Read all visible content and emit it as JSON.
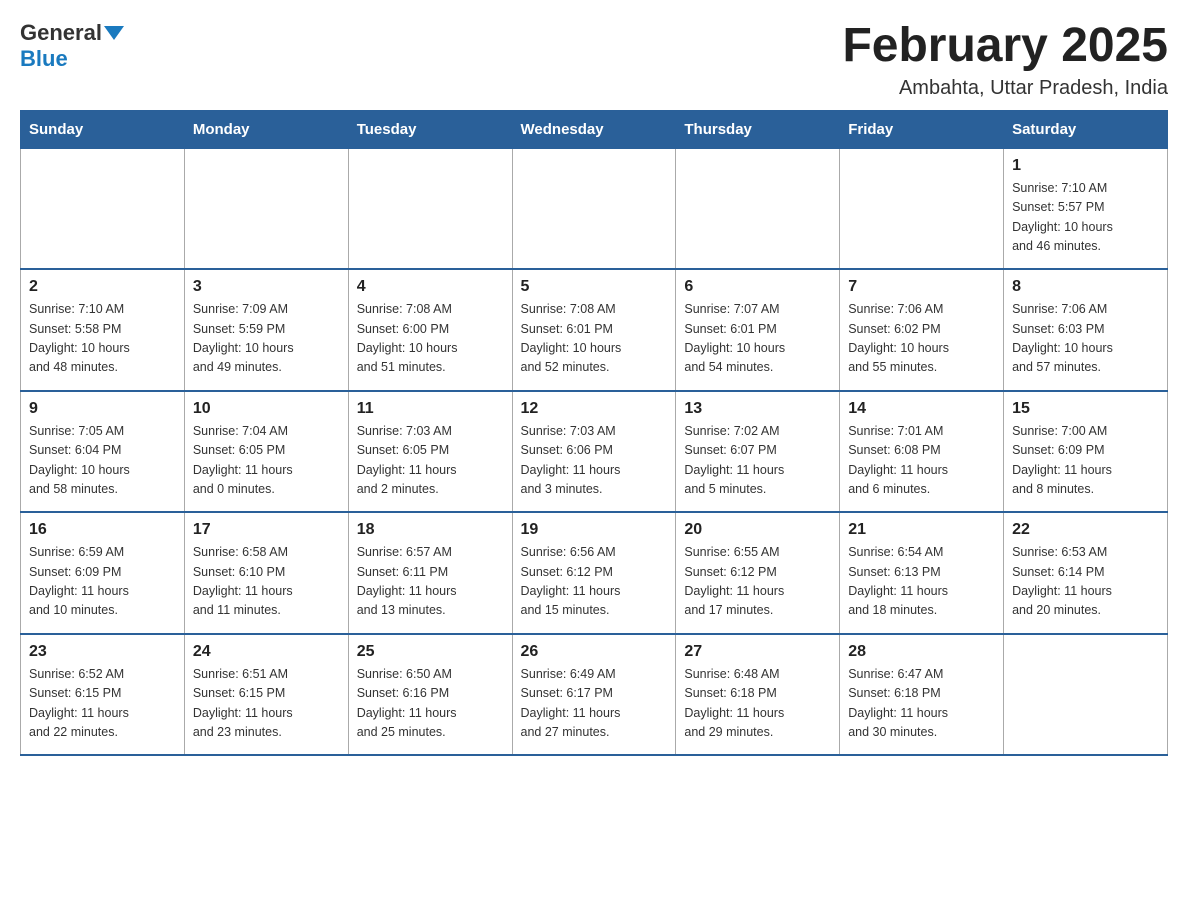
{
  "header": {
    "logo_general": "General",
    "logo_blue": "Blue",
    "month_title": "February 2025",
    "location": "Ambahta, Uttar Pradesh, India"
  },
  "weekdays": [
    "Sunday",
    "Monday",
    "Tuesday",
    "Wednesday",
    "Thursday",
    "Friday",
    "Saturday"
  ],
  "weeks": [
    [
      {
        "day": "",
        "info": ""
      },
      {
        "day": "",
        "info": ""
      },
      {
        "day": "",
        "info": ""
      },
      {
        "day": "",
        "info": ""
      },
      {
        "day": "",
        "info": ""
      },
      {
        "day": "",
        "info": ""
      },
      {
        "day": "1",
        "info": "Sunrise: 7:10 AM\nSunset: 5:57 PM\nDaylight: 10 hours\nand 46 minutes."
      }
    ],
    [
      {
        "day": "2",
        "info": "Sunrise: 7:10 AM\nSunset: 5:58 PM\nDaylight: 10 hours\nand 48 minutes."
      },
      {
        "day": "3",
        "info": "Sunrise: 7:09 AM\nSunset: 5:59 PM\nDaylight: 10 hours\nand 49 minutes."
      },
      {
        "day": "4",
        "info": "Sunrise: 7:08 AM\nSunset: 6:00 PM\nDaylight: 10 hours\nand 51 minutes."
      },
      {
        "day": "5",
        "info": "Sunrise: 7:08 AM\nSunset: 6:01 PM\nDaylight: 10 hours\nand 52 minutes."
      },
      {
        "day": "6",
        "info": "Sunrise: 7:07 AM\nSunset: 6:01 PM\nDaylight: 10 hours\nand 54 minutes."
      },
      {
        "day": "7",
        "info": "Sunrise: 7:06 AM\nSunset: 6:02 PM\nDaylight: 10 hours\nand 55 minutes."
      },
      {
        "day": "8",
        "info": "Sunrise: 7:06 AM\nSunset: 6:03 PM\nDaylight: 10 hours\nand 57 minutes."
      }
    ],
    [
      {
        "day": "9",
        "info": "Sunrise: 7:05 AM\nSunset: 6:04 PM\nDaylight: 10 hours\nand 58 minutes."
      },
      {
        "day": "10",
        "info": "Sunrise: 7:04 AM\nSunset: 6:05 PM\nDaylight: 11 hours\nand 0 minutes."
      },
      {
        "day": "11",
        "info": "Sunrise: 7:03 AM\nSunset: 6:05 PM\nDaylight: 11 hours\nand 2 minutes."
      },
      {
        "day": "12",
        "info": "Sunrise: 7:03 AM\nSunset: 6:06 PM\nDaylight: 11 hours\nand 3 minutes."
      },
      {
        "day": "13",
        "info": "Sunrise: 7:02 AM\nSunset: 6:07 PM\nDaylight: 11 hours\nand 5 minutes."
      },
      {
        "day": "14",
        "info": "Sunrise: 7:01 AM\nSunset: 6:08 PM\nDaylight: 11 hours\nand 6 minutes."
      },
      {
        "day": "15",
        "info": "Sunrise: 7:00 AM\nSunset: 6:09 PM\nDaylight: 11 hours\nand 8 minutes."
      }
    ],
    [
      {
        "day": "16",
        "info": "Sunrise: 6:59 AM\nSunset: 6:09 PM\nDaylight: 11 hours\nand 10 minutes."
      },
      {
        "day": "17",
        "info": "Sunrise: 6:58 AM\nSunset: 6:10 PM\nDaylight: 11 hours\nand 11 minutes."
      },
      {
        "day": "18",
        "info": "Sunrise: 6:57 AM\nSunset: 6:11 PM\nDaylight: 11 hours\nand 13 minutes."
      },
      {
        "day": "19",
        "info": "Sunrise: 6:56 AM\nSunset: 6:12 PM\nDaylight: 11 hours\nand 15 minutes."
      },
      {
        "day": "20",
        "info": "Sunrise: 6:55 AM\nSunset: 6:12 PM\nDaylight: 11 hours\nand 17 minutes."
      },
      {
        "day": "21",
        "info": "Sunrise: 6:54 AM\nSunset: 6:13 PM\nDaylight: 11 hours\nand 18 minutes."
      },
      {
        "day": "22",
        "info": "Sunrise: 6:53 AM\nSunset: 6:14 PM\nDaylight: 11 hours\nand 20 minutes."
      }
    ],
    [
      {
        "day": "23",
        "info": "Sunrise: 6:52 AM\nSunset: 6:15 PM\nDaylight: 11 hours\nand 22 minutes."
      },
      {
        "day": "24",
        "info": "Sunrise: 6:51 AM\nSunset: 6:15 PM\nDaylight: 11 hours\nand 23 minutes."
      },
      {
        "day": "25",
        "info": "Sunrise: 6:50 AM\nSunset: 6:16 PM\nDaylight: 11 hours\nand 25 minutes."
      },
      {
        "day": "26",
        "info": "Sunrise: 6:49 AM\nSunset: 6:17 PM\nDaylight: 11 hours\nand 27 minutes."
      },
      {
        "day": "27",
        "info": "Sunrise: 6:48 AM\nSunset: 6:18 PM\nDaylight: 11 hours\nand 29 minutes."
      },
      {
        "day": "28",
        "info": "Sunrise: 6:47 AM\nSunset: 6:18 PM\nDaylight: 11 hours\nand 30 minutes."
      },
      {
        "day": "",
        "info": ""
      }
    ]
  ]
}
